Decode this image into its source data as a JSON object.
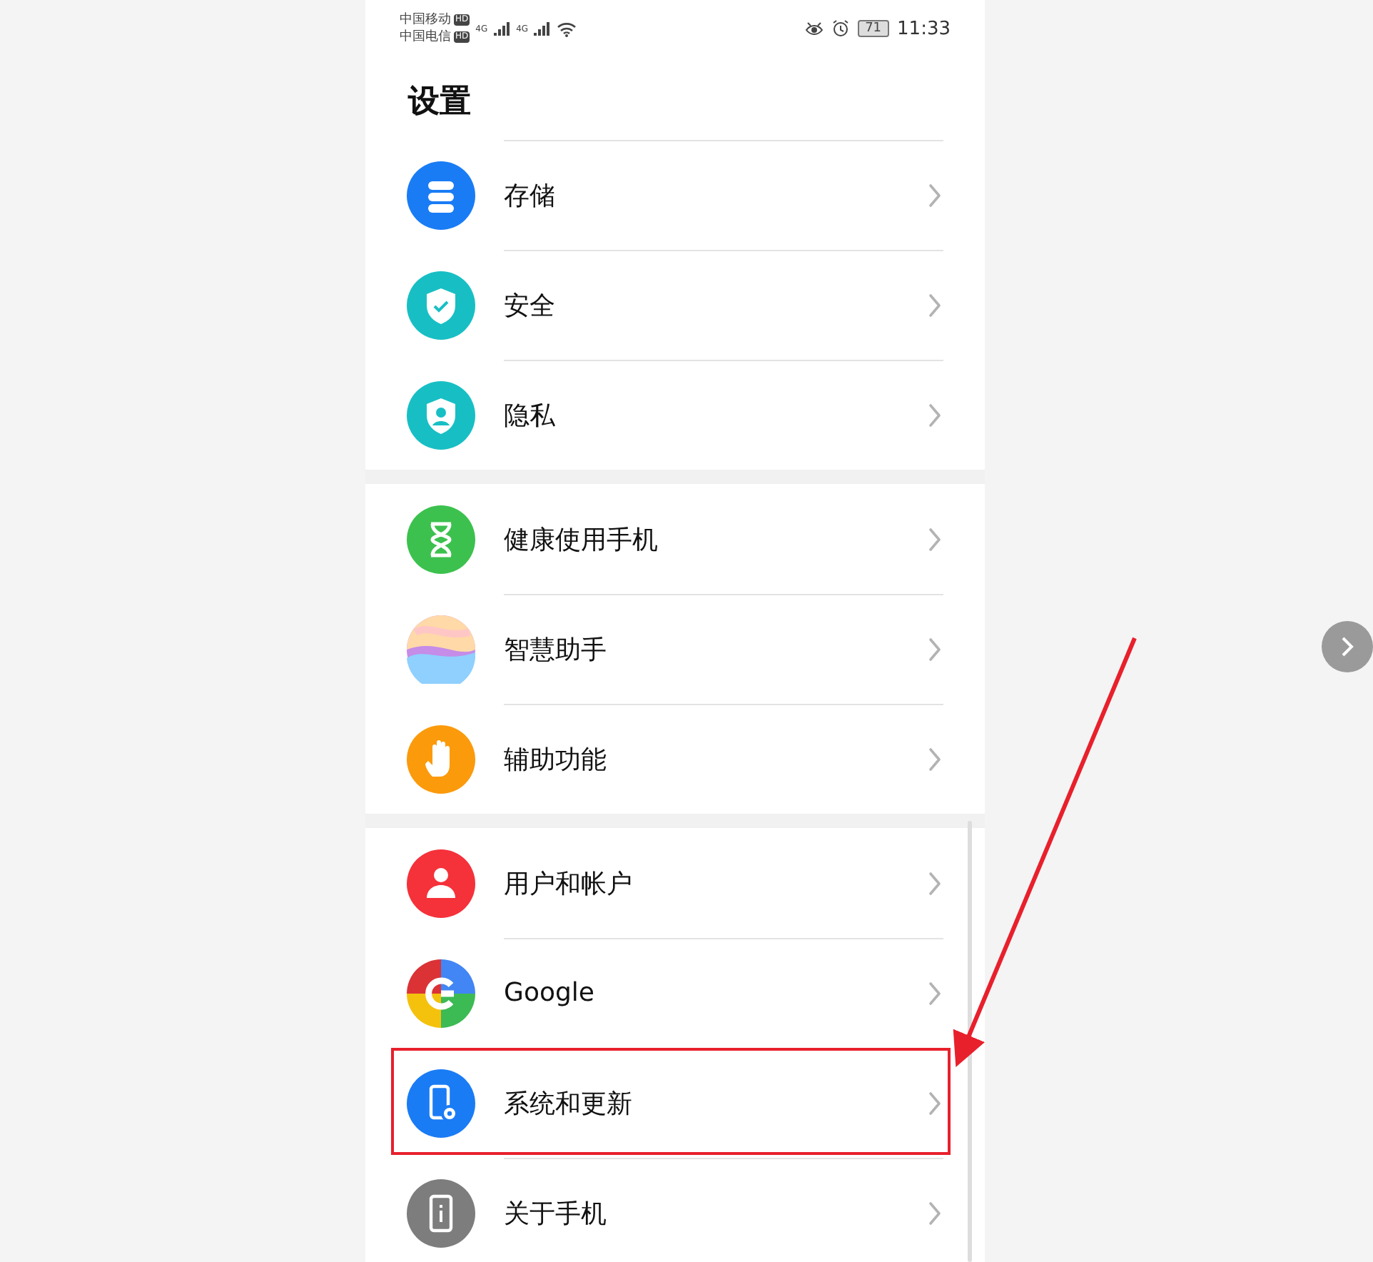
{
  "status_bar": {
    "carriers": [
      {
        "name": "中国移动",
        "badge": "HD"
      },
      {
        "name": "中国电信",
        "badge": "HD"
      }
    ],
    "signals": [
      "4G",
      "4G"
    ],
    "battery": "71",
    "time": "11:33"
  },
  "title": "设置",
  "groups": [
    {
      "items": [
        {
          "label": "存储",
          "kind": "storage",
          "color": "#1a7cf5",
          "highlighted": false
        },
        {
          "label": "安全",
          "kind": "shield",
          "color": "#17bfc4",
          "highlighted": false
        },
        {
          "label": "隐私",
          "kind": "privacy",
          "color": "#17bfc4",
          "highlighted": false
        }
      ]
    },
    {
      "items": [
        {
          "label": "健康使用手机",
          "kind": "hourglass",
          "color": "#3cc14e",
          "highlighted": false
        },
        {
          "label": "智慧助手",
          "kind": "orb",
          "color": "#c58ce8",
          "highlighted": false
        },
        {
          "label": "辅助功能",
          "kind": "hand",
          "color": "#fb9a0b",
          "highlighted": false
        }
      ]
    },
    {
      "items": [
        {
          "label": "用户和帐户",
          "kind": "user",
          "color": "#f5313a",
          "highlighted": false
        },
        {
          "label": "Google",
          "kind": "google",
          "color": "#4285f4",
          "highlighted": false
        },
        {
          "label": "系统和更新",
          "kind": "phone",
          "color": "#1a7cf5",
          "highlighted": true
        },
        {
          "label": "关于手机",
          "kind": "info",
          "color": "#7d7d7d",
          "highlighted": false
        }
      ]
    }
  ]
}
